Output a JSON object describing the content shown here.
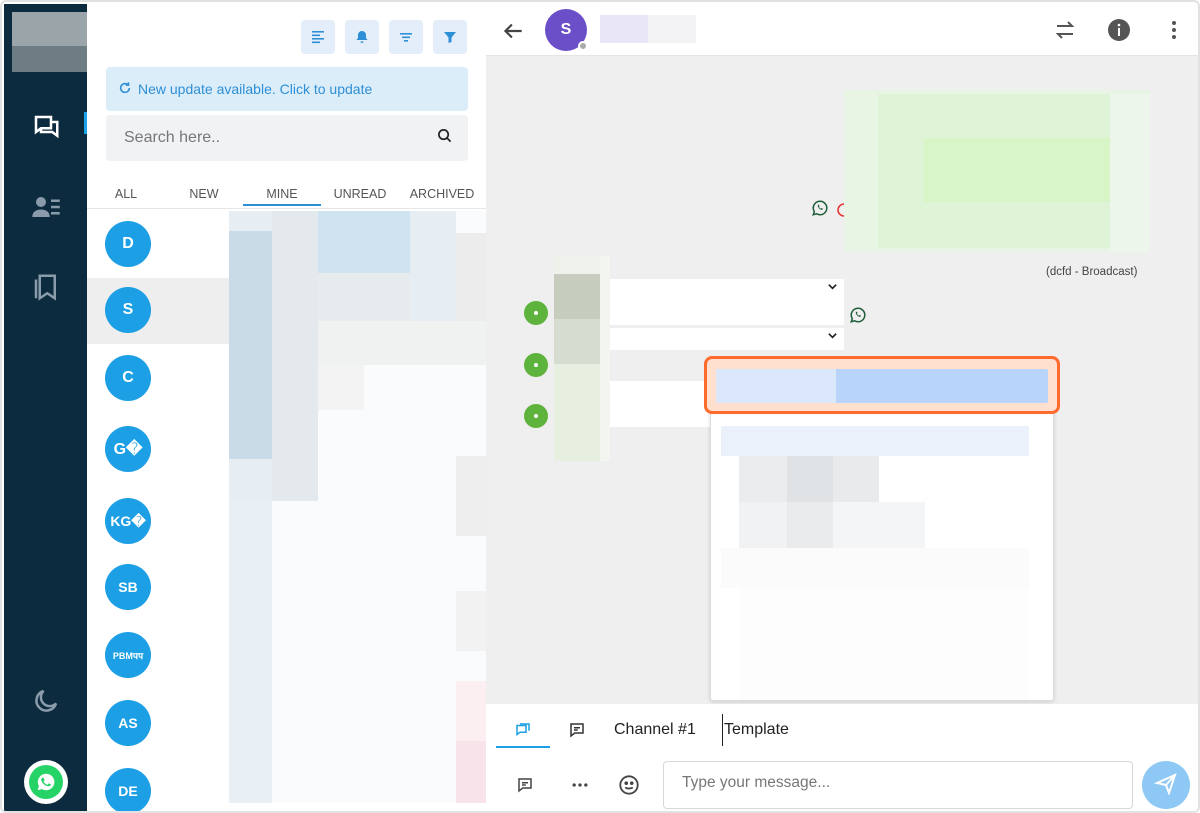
{
  "app": {
    "colors": {
      "rail": "#0d2b3e",
      "accent": "#1c9fe4",
      "highlight": "#ff6a2d"
    }
  },
  "rail": {
    "items": [
      {
        "icon": "chat-bubbles-icon",
        "active": true
      },
      {
        "icon": "contacts-icon",
        "active": false
      },
      {
        "icon": "bookmark-icon",
        "active": false
      }
    ],
    "bottom": [
      {
        "icon": "moon-icon"
      },
      {
        "icon": "whatsapp-icon"
      }
    ]
  },
  "list": {
    "toolbar": [
      "align-left-icon",
      "bell-icon",
      "sort-icon",
      "filter-icon"
    ],
    "update_banner": "New update available. Click to update",
    "search_placeholder": "Search here..",
    "tabs": [
      {
        "label": "ALL"
      },
      {
        "label": "NEW"
      },
      {
        "label": "MINE",
        "active": true
      },
      {
        "label": "UNREAD"
      },
      {
        "label": "ARCHIVED"
      }
    ],
    "conversations": [
      {
        "initials": "D"
      },
      {
        "initials": "S",
        "selected": true
      },
      {
        "initials": "C"
      },
      {
        "initials": "G�"
      },
      {
        "initials": "KG�"
      },
      {
        "initials": "SB"
      },
      {
        "initials": "PBMपप"
      },
      {
        "initials": "AS"
      },
      {
        "initials": "DE"
      }
    ]
  },
  "chat": {
    "header": {
      "avatar_initial": "S",
      "icons": [
        "swap-icon",
        "info-icon",
        "more-vertical-icon"
      ]
    },
    "broadcast_caption": "(dcfd - Broadcast)",
    "composer": {
      "tabs": [
        {
          "icon": "chat-icon",
          "active": true
        },
        {
          "icon": "note-icon"
        },
        {
          "label": "Channel #1"
        },
        {
          "label": "Template"
        }
      ],
      "placeholder": "Type your message...",
      "icons": [
        "note-icon",
        "more-dots-icon",
        "emoji-icon",
        "send-icon"
      ]
    }
  }
}
